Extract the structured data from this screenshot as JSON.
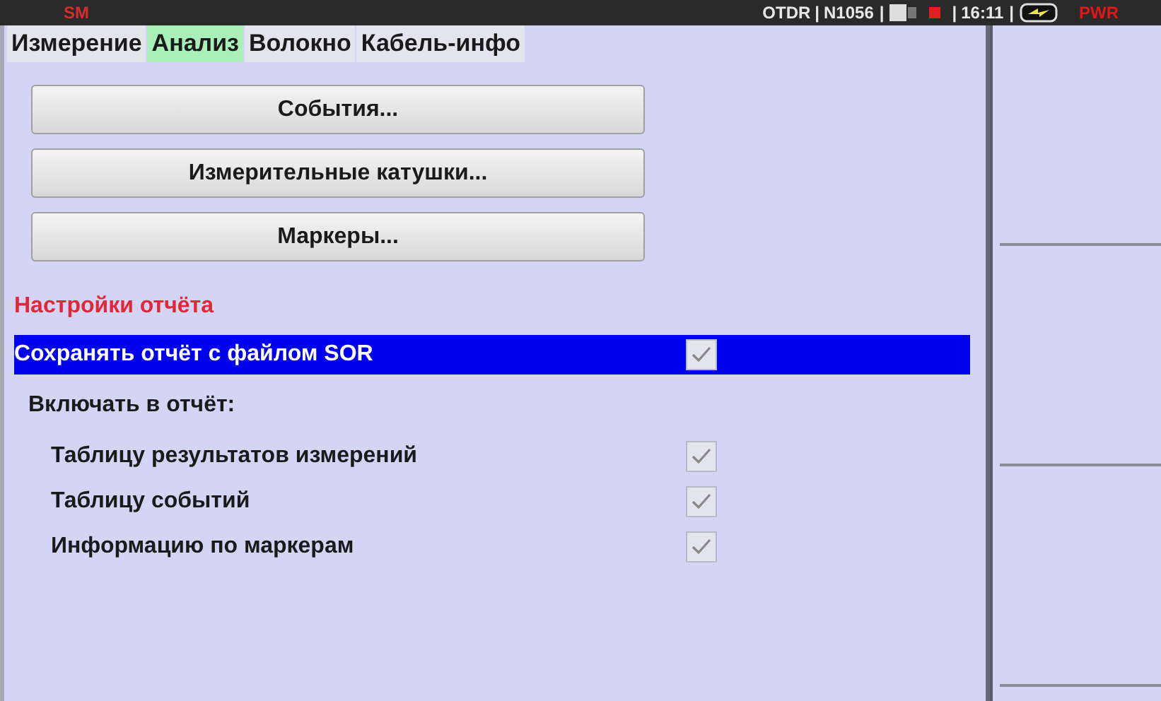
{
  "status_bar": {
    "fiber_mode": "SM",
    "module": "OTDR",
    "separator_1": "|",
    "serial": "N1056",
    "separator_2": "|",
    "recording": true,
    "separator_3": "|",
    "time": "16:11",
    "separator_4": "|",
    "power": "PWR"
  },
  "tabs": [
    {
      "label": "Измерение",
      "selected": false
    },
    {
      "label": "Анализ",
      "selected": true
    },
    {
      "label": "Волокно",
      "selected": false
    },
    {
      "label": "Кабель-инфо",
      "selected": false
    }
  ],
  "buttons": [
    "События...",
    "Измерительные катушки...",
    "Маркеры..."
  ],
  "report_settings": {
    "heading": "Настройки отчёта",
    "save_option": {
      "label": "Сохранять отчёт с файлом SOR",
      "checked": true,
      "selected": true
    },
    "include_label": "Включать в отчёт:",
    "include_items": [
      {
        "label": "Таблицу результатов измерений",
        "checked": true
      },
      {
        "label": "Таблицу событий",
        "checked": true
      },
      {
        "label": "Информацию по маркерам",
        "checked": true
      }
    ]
  }
}
